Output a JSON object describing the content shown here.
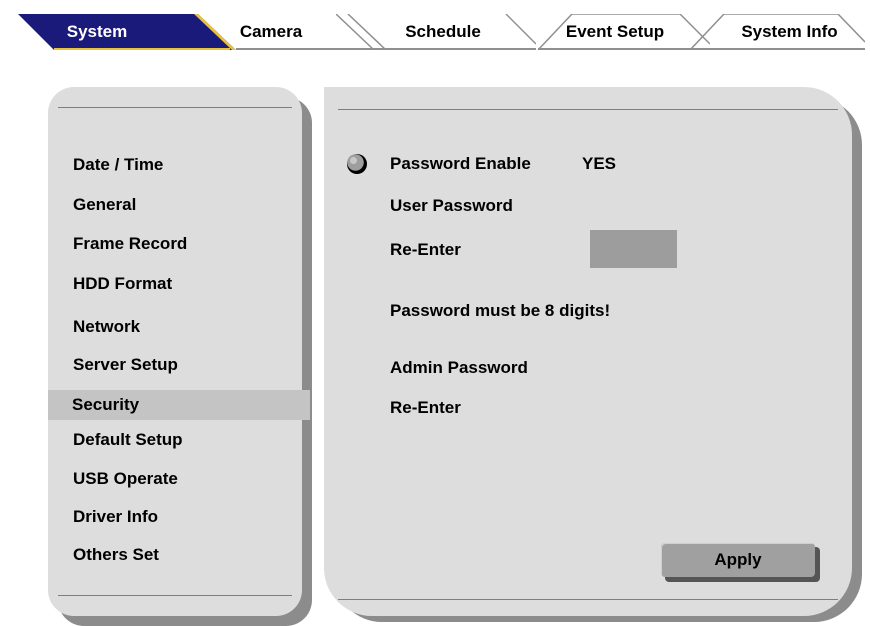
{
  "tabs": [
    {
      "label": "System",
      "active": true
    },
    {
      "label": "Camera",
      "active": false
    },
    {
      "label": "Schedule",
      "active": false
    },
    {
      "label": "Event Setup",
      "active": false
    },
    {
      "label": "System Info",
      "active": false
    }
  ],
  "sidebar": {
    "items": [
      {
        "label": "Date / Time"
      },
      {
        "label": "General"
      },
      {
        "label": "Frame Record"
      },
      {
        "label": "HDD Format"
      },
      {
        "label": "Network"
      },
      {
        "label": "Server Setup"
      },
      {
        "label": "Security",
        "selected": true
      },
      {
        "label": "Default Setup"
      },
      {
        "label": "USB Operate"
      },
      {
        "label": "Driver Info"
      },
      {
        "label": "Others Set"
      }
    ]
  },
  "security": {
    "password_enable_label": "Password Enable",
    "password_enable_value": "YES",
    "user_password_label": "User Password",
    "user_reenter_label": "Re-Enter",
    "user_reenter_value": "",
    "notice": "Password must be 8 digits!",
    "admin_password_label": "Admin Password",
    "admin_reenter_label": "Re-Enter",
    "apply_label": "Apply"
  },
  "colors": {
    "active_tab": "#1a1a7a",
    "active_tab_accent": "#e8c23a",
    "panel": "#dddddd",
    "selected_item": "#c4c4c4",
    "shadow": "#8c8c8c"
  },
  "icons": {
    "radio": "radio-selected-icon"
  }
}
